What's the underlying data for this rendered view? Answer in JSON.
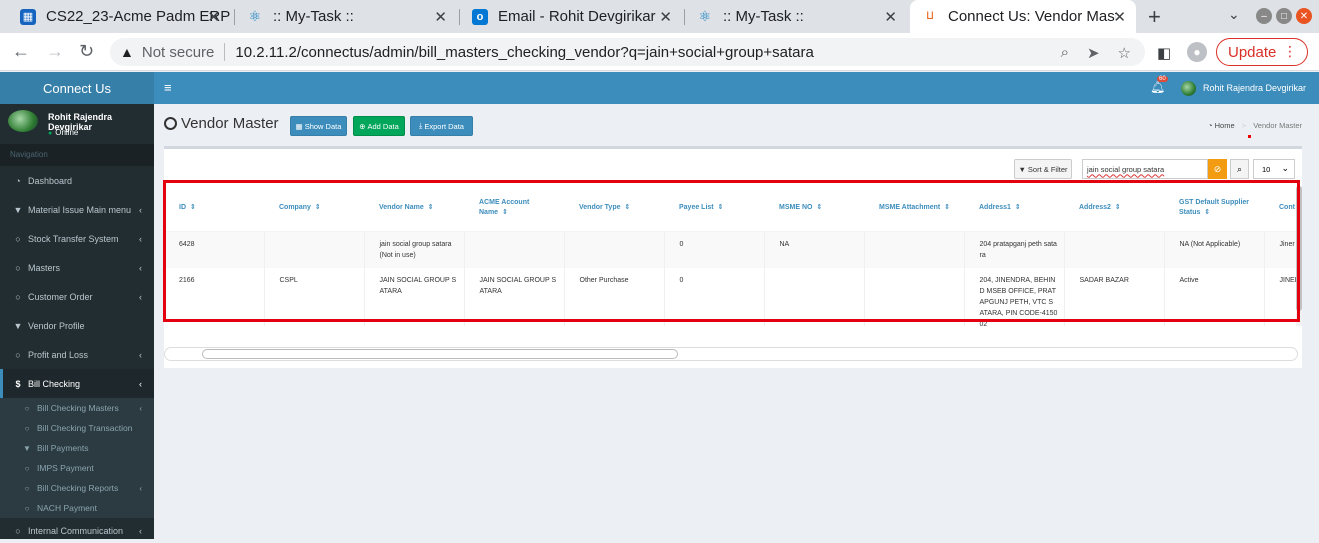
{
  "browser": {
    "tabs": [
      {
        "title": "CS22_23-Acme Padm ERP",
        "icon": "erp-icon"
      },
      {
        "title": ":: My-Task ::",
        "icon": "react-icon"
      },
      {
        "title": "Email - Rohit Devgirikar",
        "icon": "outlook-icon"
      },
      {
        "title": ":: My-Task ::",
        "icon": "react-icon"
      },
      {
        "title": "Connect Us: Vendor Master",
        "icon": "connectus-icon"
      }
    ],
    "security_label": "Not secure",
    "url": "10.2.11.2/connectus/admin/bill_masters_checking_vendor?q=jain+social+group+satara",
    "update_label": "Update"
  },
  "app": {
    "brand": "Connect Us",
    "user_name": "Rohit Rajendra Devgirikar",
    "user_status": "Online",
    "nav_label": "Navigation",
    "notification_count": "60",
    "menu": [
      {
        "label": "Dashboard",
        "icon": "dashboard-icon",
        "chevron": false
      },
      {
        "label": "Material Issue Main menu",
        "icon": "filter-icon",
        "chevron": true
      },
      {
        "label": "Stock Transfer System",
        "icon": "circle-icon",
        "chevron": true
      },
      {
        "label": "Masters",
        "icon": "circle-icon",
        "chevron": true
      },
      {
        "label": "Customer Order",
        "icon": "circle-icon",
        "chevron": true
      },
      {
        "label": "Vendor Profile",
        "icon": "filter-icon",
        "chevron": false
      },
      {
        "label": "Profit and Loss",
        "icon": "circle-icon",
        "chevron": true
      },
      {
        "label": "Bill Checking",
        "icon": "dollar-icon",
        "chevron": true
      }
    ],
    "submenu": [
      {
        "label": "Bill Checking Masters",
        "icon": "circle-icon",
        "chevron": true
      },
      {
        "label": "Bill Checking Transaction",
        "icon": "circle-icon",
        "chevron": false
      },
      {
        "label": "Bill Payments",
        "icon": "filter-icon",
        "chevron": false
      },
      {
        "label": "IMPS Payment",
        "icon": "circle-icon",
        "chevron": false
      },
      {
        "label": "Bill Checking Reports",
        "icon": "circle-icon",
        "chevron": true
      },
      {
        "label": "NACH Payment",
        "icon": "circle-icon",
        "chevron": false
      }
    ],
    "menu_last": {
      "label": "Internal Communication",
      "icon": "circle-icon",
      "chevron": true
    }
  },
  "page": {
    "title": "Vendor Master",
    "buttons": {
      "show": "Show Data",
      "add": "Add Data",
      "export": "Export Data"
    },
    "breadcrumb": {
      "home": "Home",
      "current": "Vendor Master"
    },
    "toolbar": {
      "sort_filter": "Sort & Filter",
      "search_value": "jain social group satara",
      "page_size": "10"
    },
    "table": {
      "columns": [
        "ID",
        "Company",
        "Vendor Name",
        "ACME Account Name",
        "Vendor Type",
        "Payee List",
        "MSME NO",
        "MSME Attachment",
        "Address1",
        "Address2",
        "GST Default Supplier Status",
        "Cont"
      ],
      "rows": [
        [
          "6428",
          "",
          "jain social group satara(Not in use)",
          "",
          "",
          "0",
          "NA",
          "",
          "204 pratapganj peth satara",
          "",
          "NA (Not Applicable)",
          "Jiner"
        ],
        [
          "2166",
          "CSPL",
          "JAIN SOCIAL GROUP SATARA",
          "JAIN SOCIAL GROUP SATARA",
          "Other Purchase",
          "0",
          "",
          "",
          "204, JINENDRA, BEHIND MSEB OFFICE, PRATAPGUNJ PETH, VTC SATARA, PIN CODE-415002",
          "SADAR BAZAR",
          "Active",
          "JINEI UGLE"
        ]
      ]
    }
  },
  "colors": {
    "brand": "#367fa9",
    "topnav": "#3c8dbc",
    "sidebar": "#222d32",
    "highlight": "#e3000f",
    "add_button": "#00a65a",
    "clear_button": "#f39c12"
  }
}
